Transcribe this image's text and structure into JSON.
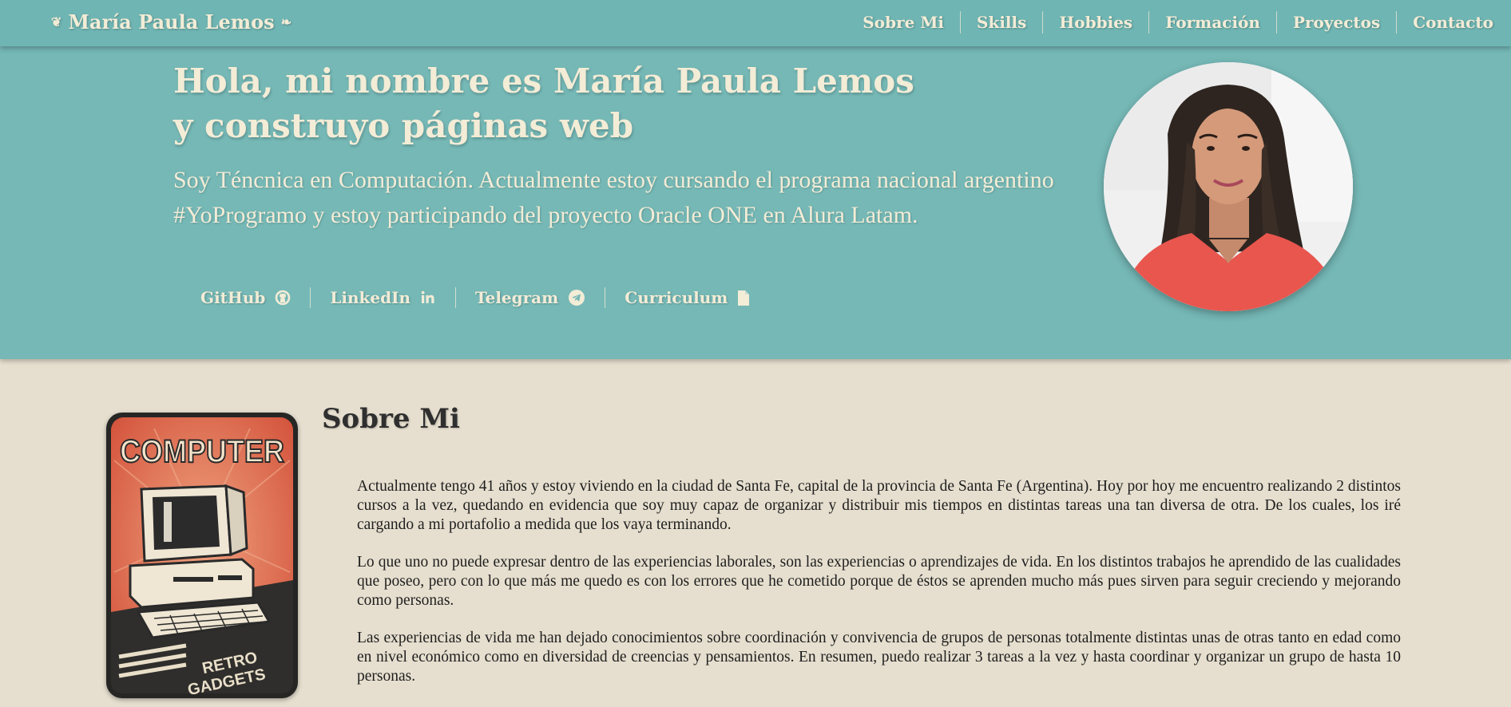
{
  "nav": {
    "brand": "María Paula Lemos",
    "items": [
      "Sobre Mi",
      "Skills",
      "Hobbies",
      "Formación",
      "Proyectos",
      "Contacto"
    ]
  },
  "hero": {
    "title": "Hola, mi nombre es María Paula Lemos y construyo páginas web",
    "subtitle": "Soy Téncnica en Computación. Actualmente estoy cursando el programa nacional argentino #YoProgramo y estoy participando del proyecto Oracle ONE en Alura Latam.",
    "links": [
      {
        "label": "GitHub",
        "icon": "github-icon"
      },
      {
        "label": "LinkedIn",
        "icon": "linkedin-icon"
      },
      {
        "label": "Telegram",
        "icon": "telegram-icon"
      },
      {
        "label": "Curriculum",
        "icon": "file-icon"
      }
    ]
  },
  "about": {
    "title": "Sobre Mi",
    "poster": {
      "top": "COMPUTER",
      "bottom": [
        "RETRO",
        "GADGETS"
      ]
    },
    "paragraphs": [
      "Actualmente tengo 41 años y estoy viviendo en la ciudad de Santa Fe, capital de la provincia de Santa Fe (Argentina). Hoy por hoy me encuentro realizando 2 distintos cursos a la vez, quedando en evidencia que soy muy capaz de organizar y distribuir mis tiempos en distintas tareas una tan diversa de otra. De los cuales, los iré cargando a mi portafolio a medida que los vaya terminando.",
      "Lo que uno no puede expresar dentro de las experiencias laborales, son las experiencias o aprendizajes de vida. En los distintos trabajos he aprendido de las cualidades que poseo, pero con lo que más me quedo es con los errores que he cometido porque de éstos se aprenden mucho más pues sirven para seguir creciendo y mejorando como personas.",
      "Las experiencias de vida me han dejado conocimientos sobre coordinación y convivencia de grupos de personas totalmente distintas unas de otras tanto en edad como en nivel económico como en diversidad de creencias y pensamientos. En resumen, puedo realizar 3 tareas a la vez y hasta coordinar y organizar un grupo de hasta 10 personas."
    ]
  },
  "colors": {
    "teal": "#75b8b6",
    "cream": "#f3ecd6",
    "background": "#e6dfcf"
  }
}
